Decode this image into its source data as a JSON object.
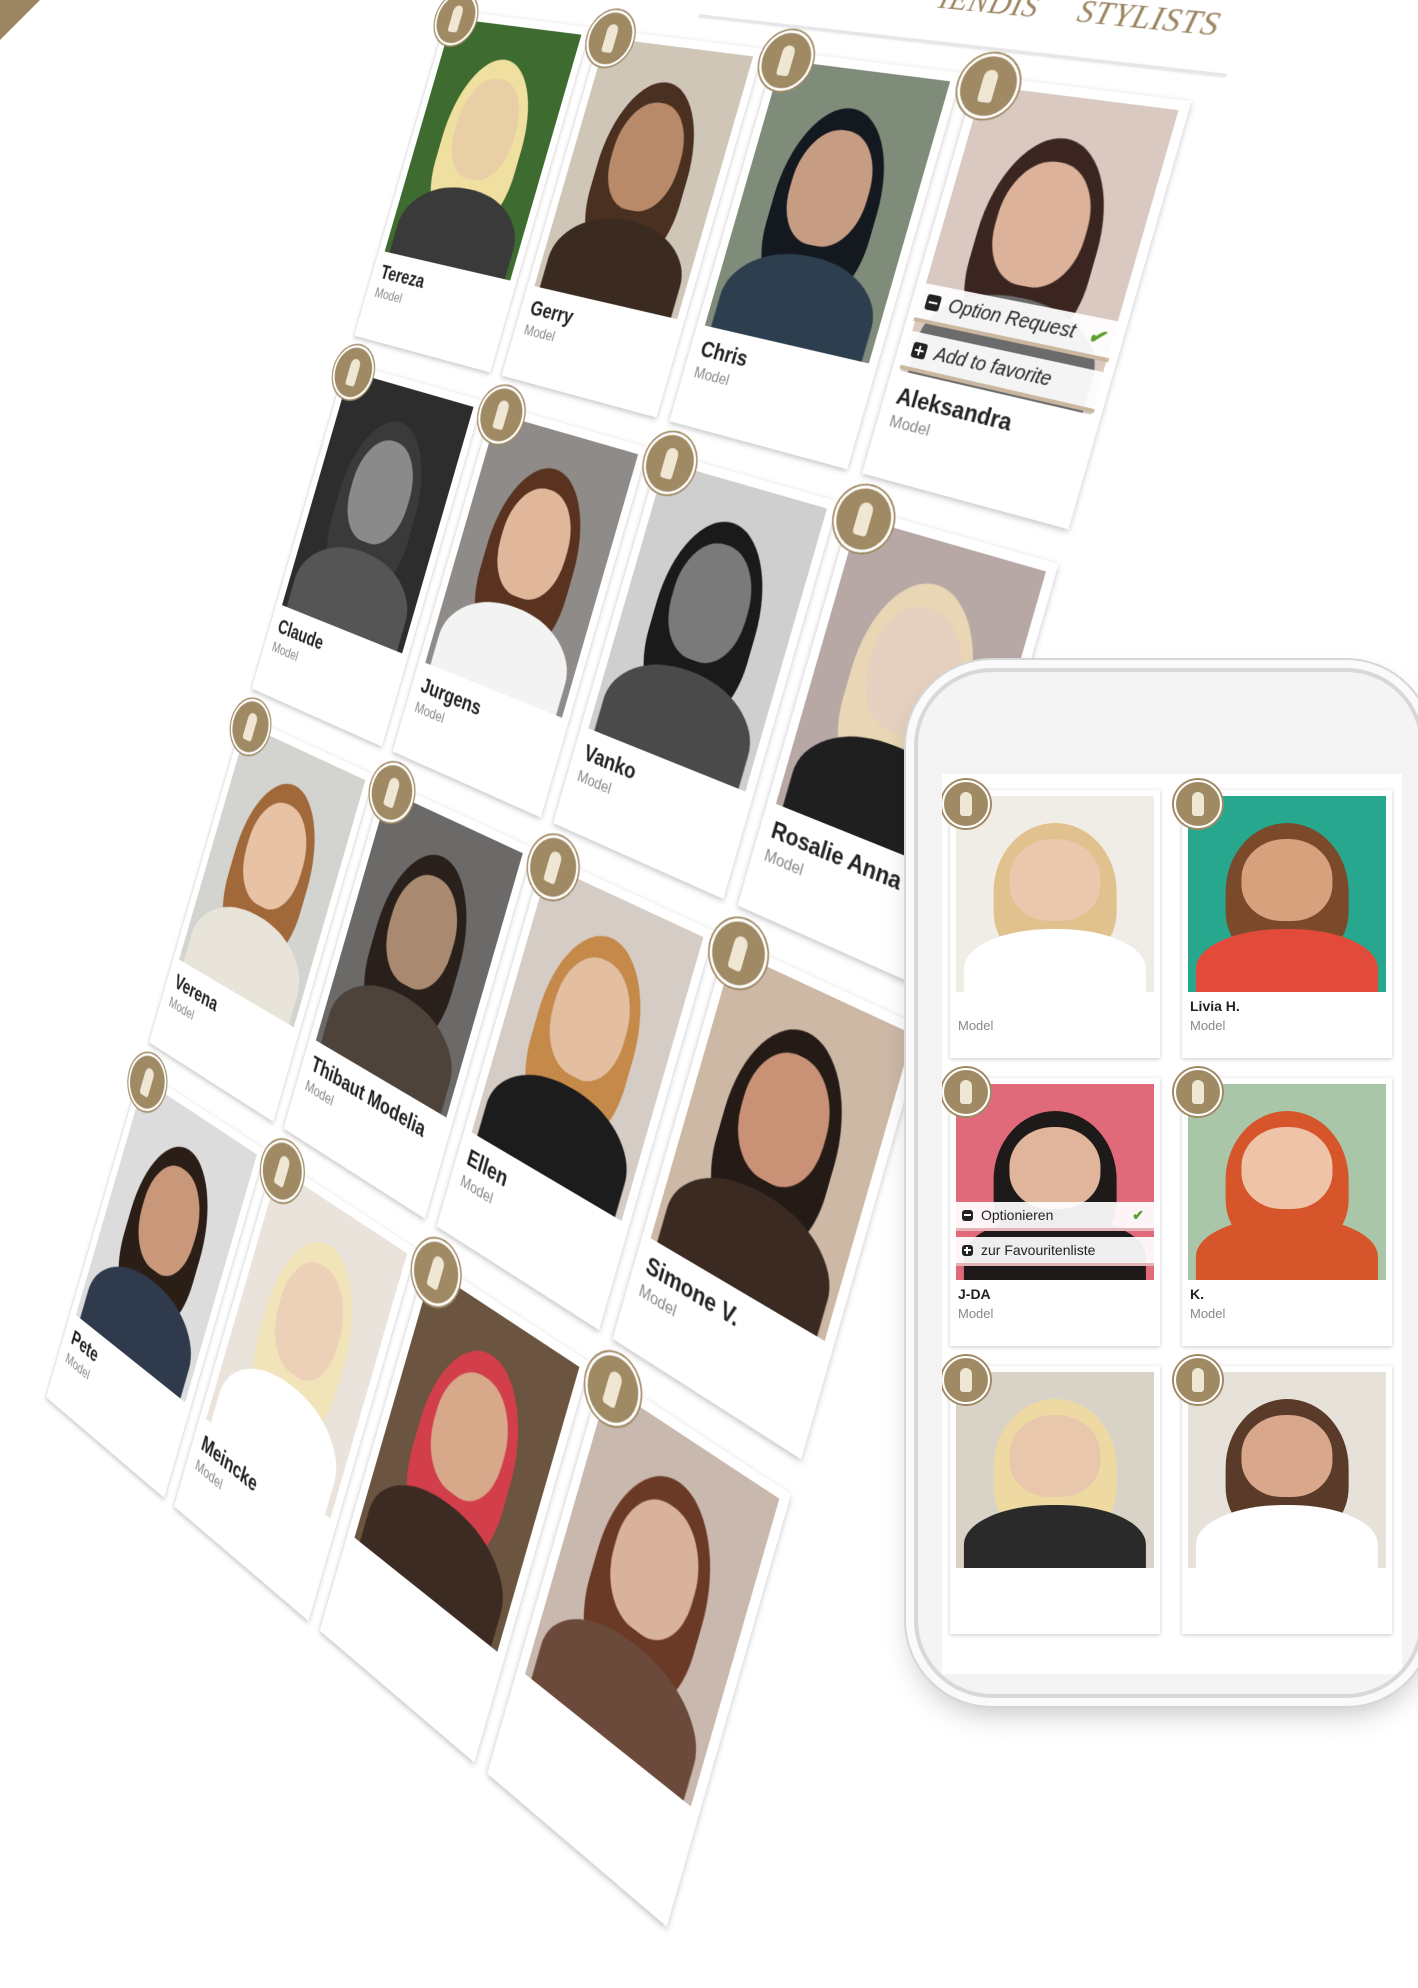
{
  "nav": {
    "items": [
      "IENDIS",
      "STYLISTS"
    ]
  },
  "desktop": {
    "option_request_label": "Option Request",
    "add_favorite_label": "Add to favorite",
    "cards": [
      {
        "name": "Tereza",
        "role": "Model",
        "palette": [
          "#3e6b2f",
          "#e9cfa6",
          "#efe0a0",
          "#3a3a3a"
        ]
      },
      {
        "name": "Gerry",
        "role": "Model",
        "palette": [
          "#cfc6b8",
          "#b88a6a",
          "#4a3020",
          "#3a2a20"
        ]
      },
      {
        "name": "Chris",
        "role": "Model",
        "palette": [
          "#7f8c7a",
          "#c69c82",
          "#14181f",
          "#2d3f4e"
        ]
      },
      {
        "name": "Aleksandra",
        "role": "Model",
        "palette": [
          "#d9c9c0",
          "#dcb29a",
          "#3a2520",
          "#6b6b6b"
        ],
        "has_options": true
      },
      {
        "name": "Claude",
        "role": "Model",
        "palette": [
          "#2d2d2d",
          "#8a8a8a",
          "#3a3a3a",
          "#555555"
        ]
      },
      {
        "name": "Jurgens",
        "role": "Model",
        "palette": [
          "#8f8b88",
          "#e1b79c",
          "#5a3320",
          "#f3f3f3"
        ]
      },
      {
        "name": "Vanko",
        "role": "Model",
        "palette": [
          "#cfcfcf",
          "#7a7a7a",
          "#1a1a1a",
          "#4a4a4a"
        ]
      },
      {
        "name": "Rosalie Anna",
        "role": "Model",
        "palette": [
          "#b7a8a6",
          "#e6d0bf",
          "#e8d6b4",
          "#1f1f1f"
        ]
      },
      {
        "name": "Verena",
        "role": "Model",
        "palette": [
          "#d3d3cf",
          "#e7c2a5",
          "#a1683a",
          "#e8e4da"
        ]
      },
      {
        "name": "Thibaut Modelia",
        "role": "Model",
        "palette": [
          "#6c6a68",
          "#a98a70",
          "#2a201b",
          "#4d433b"
        ]
      },
      {
        "name": "Ellen",
        "role": "Model",
        "palette": [
          "#d5cdc5",
          "#e3bea1",
          "#c58a4a",
          "#1c1c1c"
        ]
      },
      {
        "name": "Simone V.",
        "role": "Model",
        "palette": [
          "#cdb8a6",
          "#c99276",
          "#241a16",
          "#3a2a22"
        ]
      },
      {
        "name": "Pete",
        "role": "Model",
        "palette": [
          "#dcdcdc",
          "#c9977a",
          "#2a1e16",
          "#2f3a4c"
        ]
      },
      {
        "name": "Meincke",
        "role": "Model",
        "palette": [
          "#e9e3dc",
          "#edd0b8",
          "#f1e4b8",
          "#ffffff"
        ]
      },
      {
        "name": "",
        "role": "",
        "palette": [
          "#6b5540",
          "#d7a88a",
          "#d23f4a",
          "#3b2b22"
        ]
      },
      {
        "name": "",
        "role": "",
        "palette": [
          "#c9b8ae",
          "#d9b29b",
          "#6b3a26",
          "#6b4a3b"
        ]
      }
    ]
  },
  "phone": {
    "option_label": "Optionieren",
    "favorite_label": "zur Favouritenliste",
    "cards": [
      {
        "name": "",
        "role": "Model",
        "palette": [
          "#f0ece6",
          "#ebc7ad",
          "#e1c18e",
          "#ffffff"
        ]
      },
      {
        "name": "Livia H.",
        "role": "Model",
        "palette": [
          "#27a88e",
          "#d7a17e",
          "#7a4a2a",
          "#e24a3a"
        ]
      },
      {
        "name": "J-DA",
        "role": "Model",
        "palette": [
          "#e06a7a",
          "#e1b49c",
          "#1f1a1a",
          "#1f1a1a"
        ],
        "has_options": true
      },
      {
        "name": "K.",
        "role": "Model",
        "palette": [
          "#a9c6a8",
          "#eec3a8",
          "#d6552a",
          "#d6552a"
        ]
      },
      {
        "name": "",
        "role": "",
        "palette": [
          "#d9d3c7",
          "#e8c7ad",
          "#efd9a3",
          "#2a2a2a"
        ]
      },
      {
        "name": "",
        "role": "",
        "palette": [
          "#e7e2d9",
          "#d9a88c",
          "#5a3a28",
          "#ffffff"
        ]
      }
    ]
  },
  "colors": {
    "brand_gold": "#a08a64",
    "check_green": "#5aa02c"
  }
}
